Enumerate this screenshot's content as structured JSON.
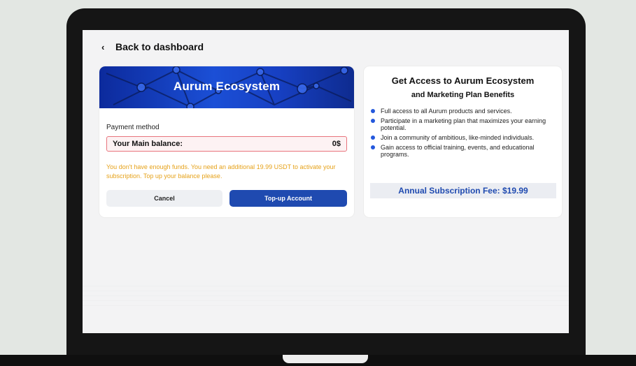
{
  "nav": {
    "back_label": "Back to dashboard",
    "back_icon": "chevron-left-icon"
  },
  "payment_card": {
    "banner_title": "Aurum Ecosystem",
    "payment_method_label": "Payment method",
    "balance_label": "Your Main balance:",
    "balance_value": "0$",
    "warning_text": "You don't have enough funds. You need an additional 19.99 USDT to activate your subscription. Top up your balance please.",
    "cancel_label": "Cancel",
    "topup_label": "Top-up Account"
  },
  "info_card": {
    "title": "Get Access to Aurum Ecosystem",
    "subtitle": "and Marketing Plan Benefits",
    "benefits": [
      "Full access to all Aurum products and services.",
      "Participate in a marketing plan that maximizes your earning potential.",
      "Join a community of ambitious, like-minded individuals.",
      "Gain access to official training, events, and educational programs."
    ],
    "fee_label": "Annual Subscription Fee: $19.99"
  },
  "colors": {
    "accent": "#1f4ab0",
    "warning": "#e6a21a",
    "error_border": "#e8747d",
    "bullet": "#2458dc"
  }
}
